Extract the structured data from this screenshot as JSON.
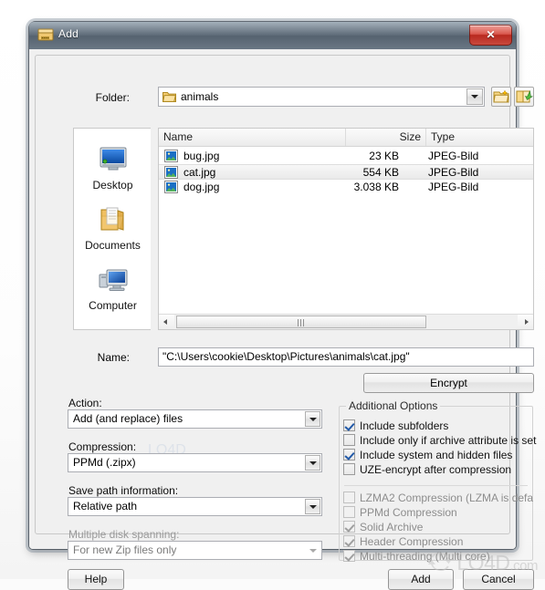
{
  "window": {
    "title": "Add",
    "title_icon": "archive-box-icon",
    "close_label": "✕"
  },
  "folder_bar": {
    "label": "Folder:",
    "value": "animals",
    "icon": "folder-icon",
    "new_folder_icon": "new-folder-icon",
    "up_folder_icon": "up-one-level-icon"
  },
  "places": [
    {
      "label": "Desktop",
      "icon": "desktop-icon"
    },
    {
      "label": "Documents",
      "icon": "documents-folder-icon"
    },
    {
      "label": "Computer",
      "icon": "computer-icon"
    }
  ],
  "file_list": {
    "columns": [
      "Name",
      "Size",
      "Type"
    ],
    "rows": [
      {
        "name": "bug.jpg",
        "size": "23 KB",
        "type": "JPEG-Bild",
        "icon": "image-file-icon",
        "selected": false
      },
      {
        "name": "cat.jpg",
        "size": "554 KB",
        "type": "JPEG-Bild",
        "icon": "image-file-icon",
        "selected": true
      },
      {
        "name": "dog.jpg",
        "size": "3.038 KB",
        "type": "JPEG-Bild",
        "icon": "image-file-icon",
        "selected": false
      }
    ]
  },
  "name_row": {
    "label": "Name:",
    "value": "\"C:\\Users\\cookie\\Desktop\\Pictures\\animals\\cat.jpg\""
  },
  "encrypt_button": "Encrypt",
  "left_options": {
    "action": {
      "label": "Action:",
      "value": "Add (and replace) files",
      "disabled": false
    },
    "compression": {
      "label": "Compression:",
      "value": "PPMd (.zipx)",
      "disabled": false
    },
    "save_path": {
      "label": "Save path information:",
      "value": "Relative path",
      "disabled": false
    },
    "disk_spanning": {
      "label": "Multiple disk spanning:",
      "value": "For new Zip files only",
      "disabled": true
    }
  },
  "additional_options": {
    "title": "Additional Options",
    "items": [
      {
        "label": "Include subfolders",
        "checked": true,
        "disabled": false
      },
      {
        "label": "Include only if archive attribute is set",
        "checked": false,
        "disabled": false
      },
      {
        "label": "Include system and hidden files",
        "checked": true,
        "disabled": false
      },
      {
        "label": "UZE-encrypt after compression",
        "checked": false,
        "disabled": false
      },
      {
        "label": "LZMA2 Compression (LZMA is defa",
        "checked": false,
        "disabled": true
      },
      {
        "label": "PPMd Compression",
        "checked": false,
        "disabled": true
      },
      {
        "label": "Solid Archive",
        "checked": true,
        "disabled": true
      },
      {
        "label": "Header Compression",
        "checked": true,
        "disabled": true
      },
      {
        "label": "Multi-threading (Multi core)",
        "checked": true,
        "disabled": true
      }
    ]
  },
  "buttons": {
    "help": "Help",
    "add": "Add",
    "cancel": "Cancel"
  },
  "watermark": {
    "text": "LO4D",
    "suffix": ".com"
  },
  "colors": {
    "titlebar": "#5e6b78",
    "close_red": "#c8493e",
    "check_blue": "#2159a8",
    "window_face": "#f0f0f0"
  }
}
